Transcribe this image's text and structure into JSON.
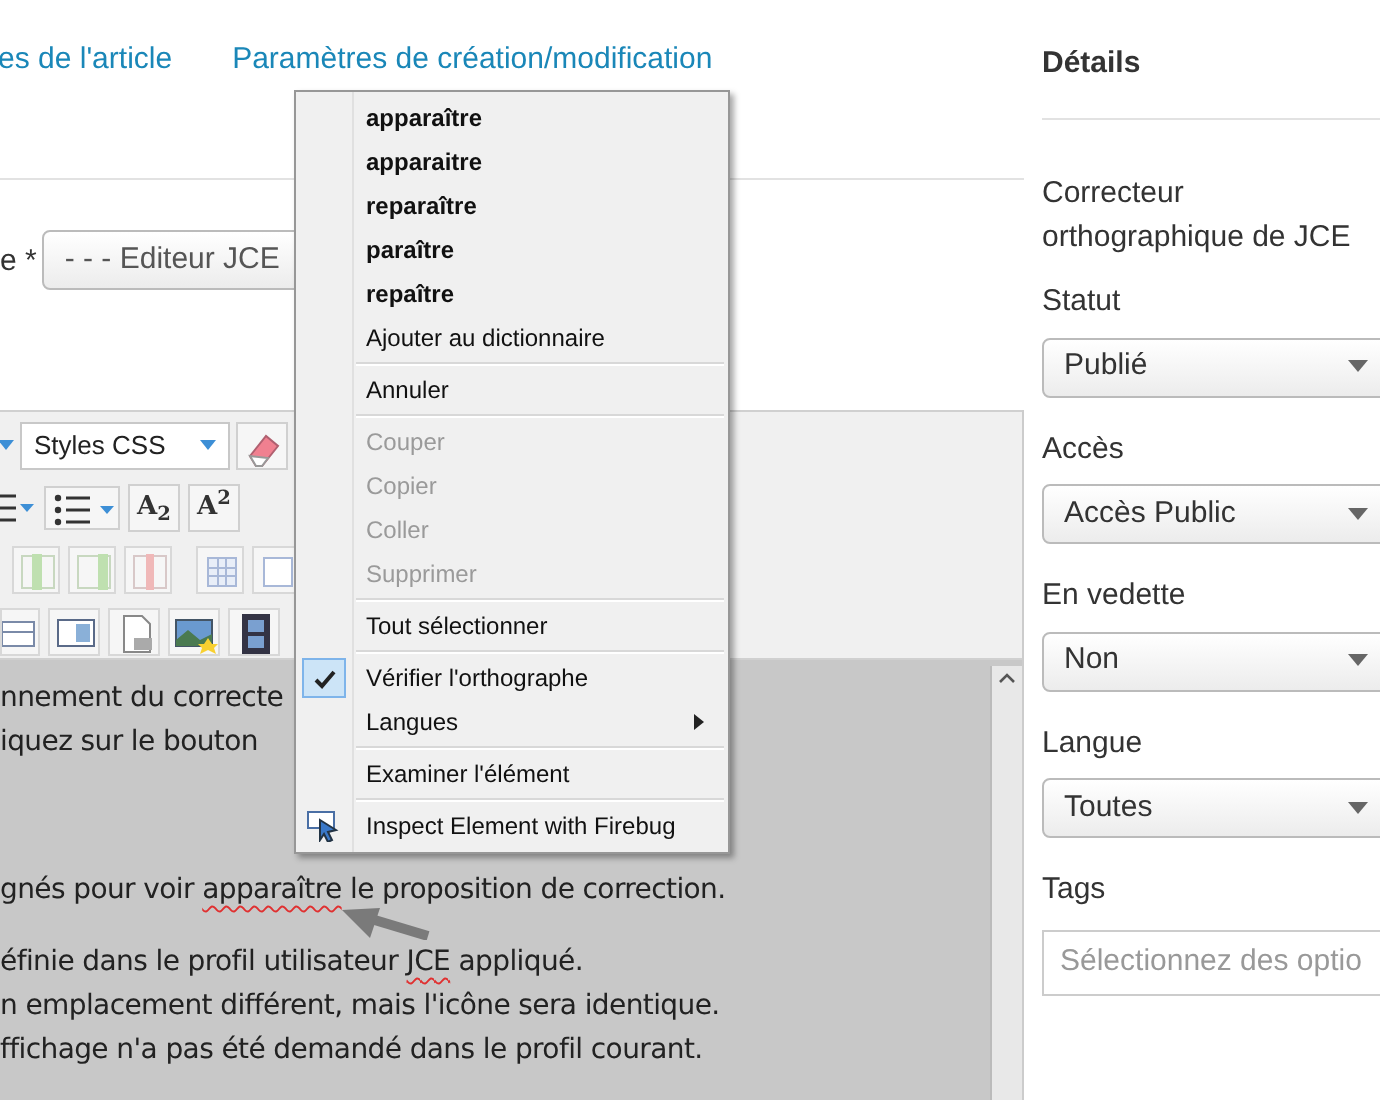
{
  "tabs": [
    {
      "label": "es de l'article"
    },
    {
      "label": "Paramètres de création/modification"
    }
  ],
  "editor_field": {
    "label": "e *",
    "value": "- - - Editeur JCE"
  },
  "toolbar": {
    "styles_select": "Styles CSS",
    "subscript": "A$_{2}$",
    "superscript": "A$^{2}$"
  },
  "content_lines": [
    {
      "segments": [
        {
          "text": "nnement du correcte",
          "misspelled": false
        }
      ]
    },
    {
      "segments": [
        {
          "text": "iquez sur le bouton",
          "misspelled": false
        }
      ]
    },
    {
      "segments": [
        {
          "text": "gnés pour voir ",
          "misspelled": false
        },
        {
          "text": "apparaître",
          "misspelled": true
        },
        {
          "text": " le proposition de correction.",
          "misspelled": false
        }
      ]
    },
    {
      "segments": [
        {
          "text": "éfinie dans le profil utilisateur ",
          "misspelled": false
        },
        {
          "text": "JCE",
          "misspelled": true
        },
        {
          "text": " appliqué.",
          "misspelled": false
        }
      ]
    },
    {
      "segments": [
        {
          "text": "n emplacement différent, mais l'icône sera identique.",
          "misspelled": false
        }
      ]
    },
    {
      "segments": [
        {
          "text": "ffichage n'a pas été demandé dans le profil courant.",
          "misspelled": false
        }
      ]
    }
  ],
  "context_menu": {
    "groups": [
      {
        "items": [
          {
            "kind": "suggestion",
            "label": "apparaître"
          },
          {
            "kind": "suggestion",
            "label": "apparaitre"
          },
          {
            "kind": "suggestion",
            "label": "reparaître"
          },
          {
            "kind": "suggestion",
            "label": "paraître"
          },
          {
            "kind": "suggestion",
            "label": "repaître"
          },
          {
            "kind": "command",
            "label": "Ajouter au dictionnaire",
            "disabled": false,
            "checked": false,
            "submenu": false
          }
        ]
      },
      {
        "items": [
          {
            "kind": "command",
            "label": "Annuler",
            "disabled": false,
            "checked": false,
            "submenu": false
          }
        ]
      },
      {
        "items": [
          {
            "kind": "command",
            "label": "Couper",
            "disabled": true,
            "checked": false,
            "submenu": false
          },
          {
            "kind": "command",
            "label": "Copier",
            "disabled": true,
            "checked": false,
            "submenu": false
          },
          {
            "kind": "command",
            "label": "Coller",
            "disabled": true,
            "checked": false,
            "submenu": false
          },
          {
            "kind": "command",
            "label": "Supprimer",
            "disabled": true,
            "checked": false,
            "submenu": false
          }
        ]
      },
      {
        "items": [
          {
            "kind": "command",
            "label": "Tout sélectionner",
            "disabled": false,
            "checked": false,
            "submenu": false
          }
        ]
      },
      {
        "items": [
          {
            "kind": "command",
            "label": "Vérifier l'orthographe",
            "disabled": false,
            "checked": true,
            "submenu": false
          },
          {
            "kind": "command",
            "label": "Langues",
            "disabled": false,
            "checked": false,
            "submenu": true
          }
        ]
      },
      {
        "items": [
          {
            "kind": "command",
            "label": "Examiner l'élément",
            "disabled": false,
            "checked": false,
            "submenu": false
          }
        ]
      },
      {
        "items": [
          {
            "kind": "extension",
            "label": "Inspect Element with Firebug",
            "disabled": false,
            "checked": false,
            "submenu": false
          }
        ]
      }
    ]
  },
  "sidebar": {
    "title": "Détails",
    "description": "Correcteur orthographique de JCE",
    "fields": [
      {
        "kind": "select",
        "label": "Statut",
        "value": "Publié"
      },
      {
        "kind": "select",
        "label": "Accès",
        "value": "Accès Public"
      },
      {
        "kind": "select",
        "label": "En vedette",
        "value": "Non"
      },
      {
        "kind": "select",
        "label": "Langue",
        "value": "Toutes"
      },
      {
        "kind": "text",
        "label": "Tags",
        "placeholder": "Sélectionnez des optio"
      }
    ]
  }
}
